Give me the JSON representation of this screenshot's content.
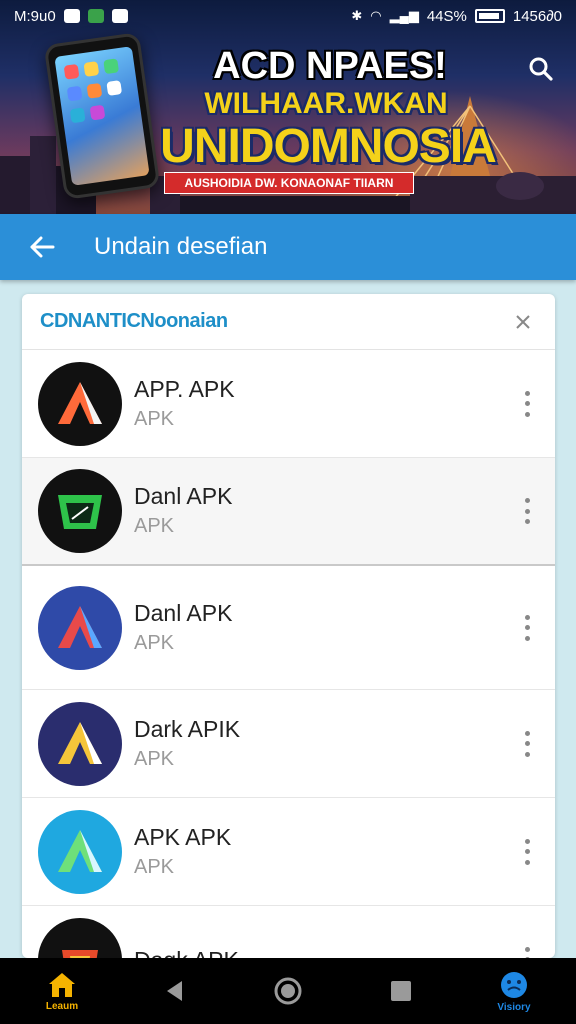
{
  "status_bar": {
    "time": "M:9u0",
    "battery": "44S%",
    "clock_right": "1456∂0"
  },
  "banner": {
    "line1": "ACD NPAES!",
    "line2": "WILHAAR.WKAN",
    "line3": "UNIDOMNOSIA",
    "ribbon": "AUSHOIDIA DW. KONAONAF TIIARN"
  },
  "appbar": {
    "title": "Undain desefian"
  },
  "card": {
    "title": "CDNANTICNoonaian"
  },
  "apps": [
    {
      "name": "APP. APK",
      "sub": "APK"
    },
    {
      "name": "Danl APK",
      "sub": "APK"
    },
    {
      "name": "Danl APK",
      "sub": "APK"
    },
    {
      "name": "Dark APIK",
      "sub": "APK"
    },
    {
      "name": "APK APK",
      "sub": "APK"
    },
    {
      "name": "Dagk APK",
      "sub": ""
    }
  ],
  "nav": {
    "home_label": "Leaum",
    "right_label": "Visiory"
  },
  "colors": {
    "appbar": "#2b8fd8",
    "card_title": "#1e8fc8",
    "home_icon": "#f5b301",
    "right_icon": "#1e88e5"
  }
}
